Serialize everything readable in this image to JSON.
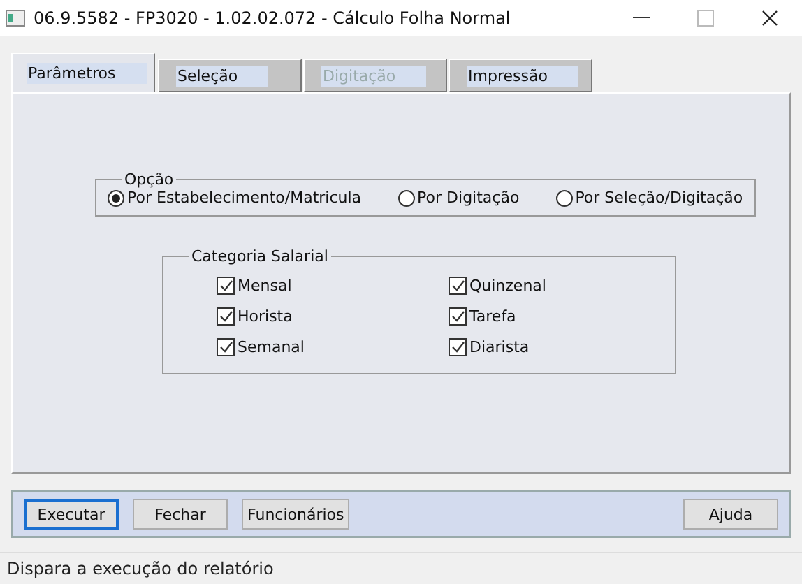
{
  "window": {
    "title": "06.9.5582 - FP3020 - 1.02.02.072 - Cálculo Folha Normal"
  },
  "tabs": [
    {
      "label": "Parâmetros",
      "selected": true,
      "disabled": false
    },
    {
      "label": "Seleção",
      "selected": false,
      "disabled": false
    },
    {
      "label": "Digitação",
      "selected": false,
      "disabled": true
    },
    {
      "label": "Impressão",
      "selected": false,
      "disabled": false
    }
  ],
  "option_group": {
    "title": "Opção",
    "options": [
      {
        "label": "Por Estabelecimento/Matricula",
        "selected": true
      },
      {
        "label": "Por Digitação",
        "selected": false
      },
      {
        "label": "Por Seleção/Digitação",
        "selected": false
      }
    ]
  },
  "category_group": {
    "title": "Categoria Salarial",
    "items": [
      {
        "label": "Mensal",
        "checked": true
      },
      {
        "label": "Quinzenal",
        "checked": true
      },
      {
        "label": "Horista",
        "checked": true
      },
      {
        "label": "Tarefa",
        "checked": true
      },
      {
        "label": "Semanal",
        "checked": true
      },
      {
        "label": "Diarista",
        "checked": true
      }
    ]
  },
  "buttons": [
    {
      "label": "Executar",
      "focused": true
    },
    {
      "label": "Fechar",
      "focused": false
    },
    {
      "label": "Funcionários",
      "focused": false
    }
  ],
  "help_button": {
    "label": "Ajuda"
  },
  "status_bar": "Dispara a execução do relatório"
}
